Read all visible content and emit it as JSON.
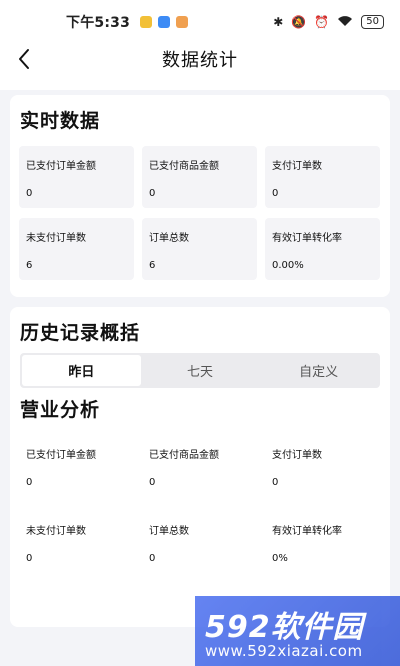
{
  "status_bar": {
    "time": "下午5:33",
    "battery": "50"
  },
  "nav": {
    "title": "数据统计"
  },
  "realtime": {
    "title": "实时数据",
    "tiles": [
      {
        "label": "已支付订单金额",
        "value": "0"
      },
      {
        "label": "已支付商品金额",
        "value": "0"
      },
      {
        "label": "支付订单数",
        "value": "0"
      },
      {
        "label": "未支付订单数",
        "value": "6"
      },
      {
        "label": "订单总数",
        "value": "6"
      },
      {
        "label": "有效订单转化率",
        "value": "0.00%"
      }
    ]
  },
  "history": {
    "title": "历史记录概括",
    "tabs": [
      "昨日",
      "七天",
      "自定义"
    ],
    "active_tab": "昨日",
    "business_title": "营业分析",
    "tiles": [
      {
        "label": "已支付订单金额",
        "value": "0"
      },
      {
        "label": "已支付商品金额",
        "value": "0"
      },
      {
        "label": "支付订单数",
        "value": "0"
      },
      {
        "label": "未支付订单数",
        "value": "0"
      },
      {
        "label": "订单总数",
        "value": "0"
      },
      {
        "label": "有效订单转化率",
        "value": "0%"
      }
    ]
  },
  "watermark": {
    "brand": "592软件园",
    "url": "www.592xiazai.com"
  },
  "colors": {
    "page_bg": "#f3f4f8",
    "tile_bg": "#f4f4f7",
    "watermark_blue": "#3a5ee8"
  }
}
